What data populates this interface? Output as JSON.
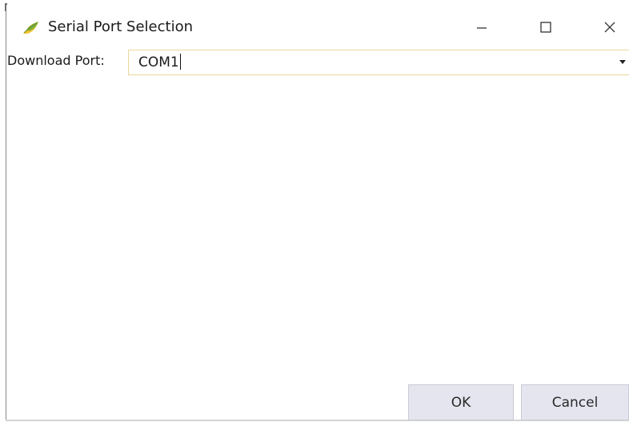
{
  "window": {
    "title": "Serial Port Selection",
    "icon": "app-leaf-icon",
    "controls": {
      "minimize_icon": "minimize-icon",
      "maximize_icon": "maximize-icon",
      "close_icon": "close-icon"
    }
  },
  "form": {
    "download_port_label": "Download Port:",
    "download_port_value": "COM1"
  },
  "buttons": {
    "ok_label": "OK",
    "cancel_label": "Cancel"
  },
  "colors": {
    "button_face": "#e4e5ee",
    "combo_border": "#e8d89a",
    "icon_yellow": "#f2c12e",
    "icon_green": "#7fb03a"
  }
}
